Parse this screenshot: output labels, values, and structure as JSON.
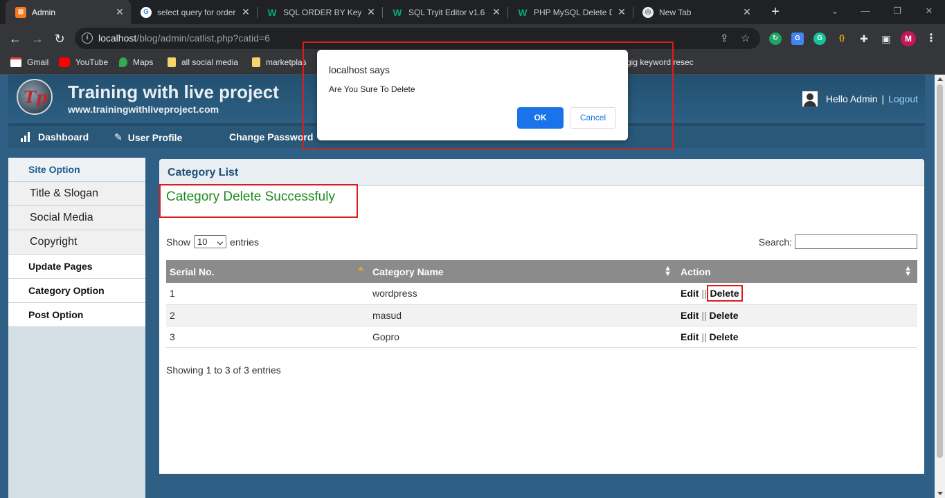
{
  "browser": {
    "tabs": [
      {
        "title": "Admin",
        "favicon": "xampp-icon",
        "active": true
      },
      {
        "title": "select query for order",
        "favicon": "google-icon"
      },
      {
        "title": "SQL ORDER BY Keywo",
        "favicon": "w3schools-icon"
      },
      {
        "title": "SQL Tryit Editor v1.6",
        "favicon": "w3schools-icon"
      },
      {
        "title": "PHP MySQL Delete D",
        "favicon": "w3schools-icon"
      },
      {
        "title": "New Tab",
        "favicon": "chrome-icon"
      }
    ],
    "url_host": "localhost",
    "url_path": "/blog/admin/catlist.php?catid=6",
    "bookmarks": [
      "Gmail",
      "YouTube",
      "Maps",
      "all social media",
      "marketplas",
      "gig keyword resec"
    ],
    "extension_avatar": "M"
  },
  "site": {
    "logo_text": "Tp",
    "title": "Training with live project",
    "subtitle": "www.trainingwithliveproject.com",
    "greeting": "Hello Admin",
    "divider": "|",
    "logout": "Logout",
    "nav": [
      "Dashboard",
      "User Profile",
      "Change Password"
    ]
  },
  "sidebar": {
    "items": [
      {
        "label": "Site Option",
        "type": "head"
      },
      {
        "label": "Title & Slogan",
        "type": "sub"
      },
      {
        "label": "Social Media",
        "type": "sub"
      },
      {
        "label": "Copyright",
        "type": "sub"
      },
      {
        "label": "Update Pages",
        "type": "bold"
      },
      {
        "label": "Category Option",
        "type": "bold"
      },
      {
        "label": "Post Option",
        "type": "bold"
      }
    ]
  },
  "content": {
    "heading": "Category List",
    "message": "Category Delete Successfuly",
    "show_label": "Show",
    "page_size": "10",
    "entries_label": "entries",
    "search_label": "Search:",
    "columns": [
      "Serial No.",
      "Category Name",
      "Action"
    ],
    "rows": [
      {
        "serial": "1",
        "name": "wordpress",
        "edit": "Edit",
        "sep": "||",
        "delete": "Delete"
      },
      {
        "serial": "2",
        "name": "masud",
        "edit": "Edit",
        "sep": "||",
        "delete": "Delete"
      },
      {
        "serial": "3",
        "name": "Gopro",
        "edit": "Edit",
        "sep": "||",
        "delete": "Delete"
      }
    ],
    "info": "Showing 1 to 3 of 3 entries"
  },
  "dialog": {
    "title": "localhost says",
    "message": "Are You Sure To Delete",
    "ok": "OK",
    "cancel": "Cancel"
  },
  "colors": {
    "accent": "#1a73e8",
    "success": "#1e8a1e",
    "highlight": "#e01b1b",
    "header_bg": "#2f5f84"
  }
}
